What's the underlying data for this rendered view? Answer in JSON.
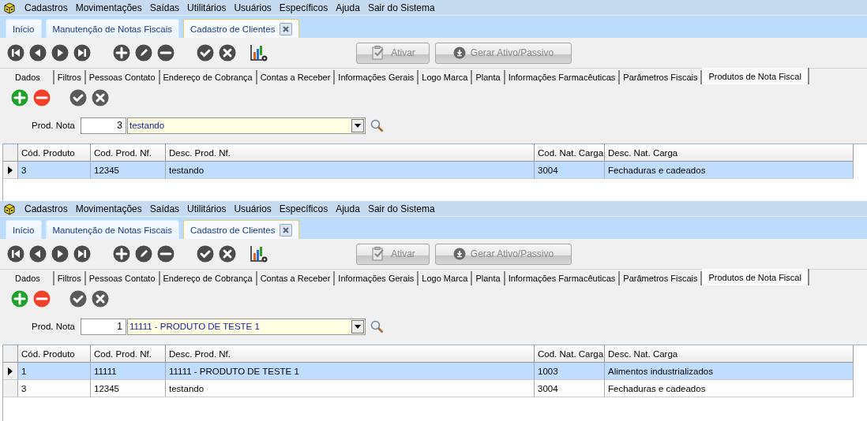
{
  "panels": [
    {
      "menu": [
        "Cadastros",
        "Movimentações",
        "Saídas",
        "Utilitários",
        "Usuários",
        "Específicos",
        "Ajuda",
        "Sair do Sistema"
      ],
      "tabs": [
        {
          "label": "Início",
          "selected": false,
          "closable": false
        },
        {
          "label": "Manutenção de Notas Fiscais",
          "selected": false,
          "closable": false
        },
        {
          "label": "Cadastro de Clientes",
          "selected": true,
          "closable": true
        }
      ],
      "buttons": [
        {
          "label": "Ativar",
          "kind": "activate",
          "disabled": true
        },
        {
          "label": "Gerar Ativo/Passivo",
          "kind": "download",
          "disabled": true
        }
      ],
      "subtabs": [
        {
          "label": "Dados",
          "selected": false
        },
        {
          "label": "Filtros",
          "selected": false
        },
        {
          "label": "Pessoas Contato",
          "selected": false
        },
        {
          "label": "Endereço de Cobrança",
          "selected": false
        },
        {
          "label": "Contas a Receber",
          "selected": false
        },
        {
          "label": "Informações Gerais",
          "selected": false
        },
        {
          "label": "Logo Marca",
          "selected": false
        },
        {
          "label": "Planta",
          "selected": false
        },
        {
          "label": "Informações Farmacêuticas",
          "selected": false
        },
        {
          "label": "Parâmetros Fiscais",
          "selected": false
        },
        {
          "label": "Produtos de Nota Fiscal",
          "selected": true
        }
      ],
      "prod_nota": {
        "label": "Prod. Nota",
        "code": "3",
        "value": "testando"
      },
      "table": {
        "columns": [
          "Cód. Produto",
          "Cod. Prod. Nf.",
          "Desc. Prod. Nf.",
          "Cod. Nat. Carga",
          "Desc. Nat. Carga"
        ],
        "rows": [
          {
            "cells": [
              "3",
              "12345",
              "testando",
              "3004",
              "Fechaduras e cadeados"
            ],
            "selected": true
          }
        ]
      }
    },
    {
      "menu": [
        "Cadastros",
        "Movimentações",
        "Saídas",
        "Utilitários",
        "Usuários",
        "Específicos",
        "Ajuda",
        "Sair do Sistema"
      ],
      "tabs": [
        {
          "label": "Início",
          "selected": false,
          "closable": false
        },
        {
          "label": "Manutenção de Notas Fiscais",
          "selected": false,
          "closable": false
        },
        {
          "label": "Cadastro de Clientes",
          "selected": true,
          "closable": true
        }
      ],
      "buttons": [
        {
          "label": "Ativar",
          "kind": "activate",
          "disabled": true
        },
        {
          "label": "Gerar Ativo/Passivo",
          "kind": "download",
          "disabled": true
        }
      ],
      "subtabs": [
        {
          "label": "Dados",
          "selected": false
        },
        {
          "label": "Filtros",
          "selected": false
        },
        {
          "label": "Pessoas Contato",
          "selected": false
        },
        {
          "label": "Endereço de Cobrança",
          "selected": false
        },
        {
          "label": "Contas a Receber",
          "selected": false
        },
        {
          "label": "Informações Gerais",
          "selected": false
        },
        {
          "label": "Logo Marca",
          "selected": false
        },
        {
          "label": "Planta",
          "selected": false
        },
        {
          "label": "Informações Farmacêuticas",
          "selected": false
        },
        {
          "label": "Parâmetros Fiscais",
          "selected": false
        },
        {
          "label": "Produtos de Nota Fiscal",
          "selected": true
        }
      ],
      "prod_nota": {
        "label": "Prod. Nota",
        "code": "1",
        "value": "11111 - PRODUTO DE TESTE 1"
      },
      "table": {
        "columns": [
          "Cód. Produto",
          "Cod. Prod. Nf.",
          "Desc. Prod. Nf.",
          "Cod. Nat. Carga",
          "Desc. Nat. Carga"
        ],
        "rows": [
          {
            "cells": [
              "1",
              "11111",
              "11111 - PRODUTO DE TESTE 1",
              "1003",
              "Alimentos industrializados"
            ],
            "selected": true
          },
          {
            "cells": [
              "3",
              "12345",
              "testando",
              "3004",
              "Fechaduras e cadeados"
            ],
            "selected": false
          }
        ]
      }
    }
  ]
}
